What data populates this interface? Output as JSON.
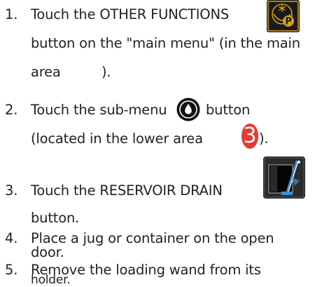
{
  "steps": [
    {
      "number": "1.",
      "lines": [
        "Touch the OTHER FUNCTIONS",
        "button on the \"main menu\" (in the main",
        "area",
        ")."
      ]
    },
    {
      "number": "2.",
      "lines": [
        "Touch the sub-menu",
        "button",
        "(located in the lower area",
        ")."
      ],
      "badge": "3"
    },
    {
      "number": "3.",
      "lines": [
        "Touch the RESERVOIR DRAIN",
        "button."
      ]
    },
    {
      "number": "4.",
      "lines": [
        "Place a jug or container on the open",
        "door."
      ]
    },
    {
      "number": "5.",
      "lines": [
        "Remove the loading wand from its",
        "holder."
      ]
    }
  ],
  "icons": {
    "other_functions": "snowflake-p-icon",
    "water_drop": "water-drop-icon",
    "reservoir_drain": "reservoir-drain-icon"
  },
  "colors": {
    "text": "#222222",
    "badge": "#e53935",
    "gold": "#d4a017",
    "icon_dark": "#1a1a1a"
  }
}
